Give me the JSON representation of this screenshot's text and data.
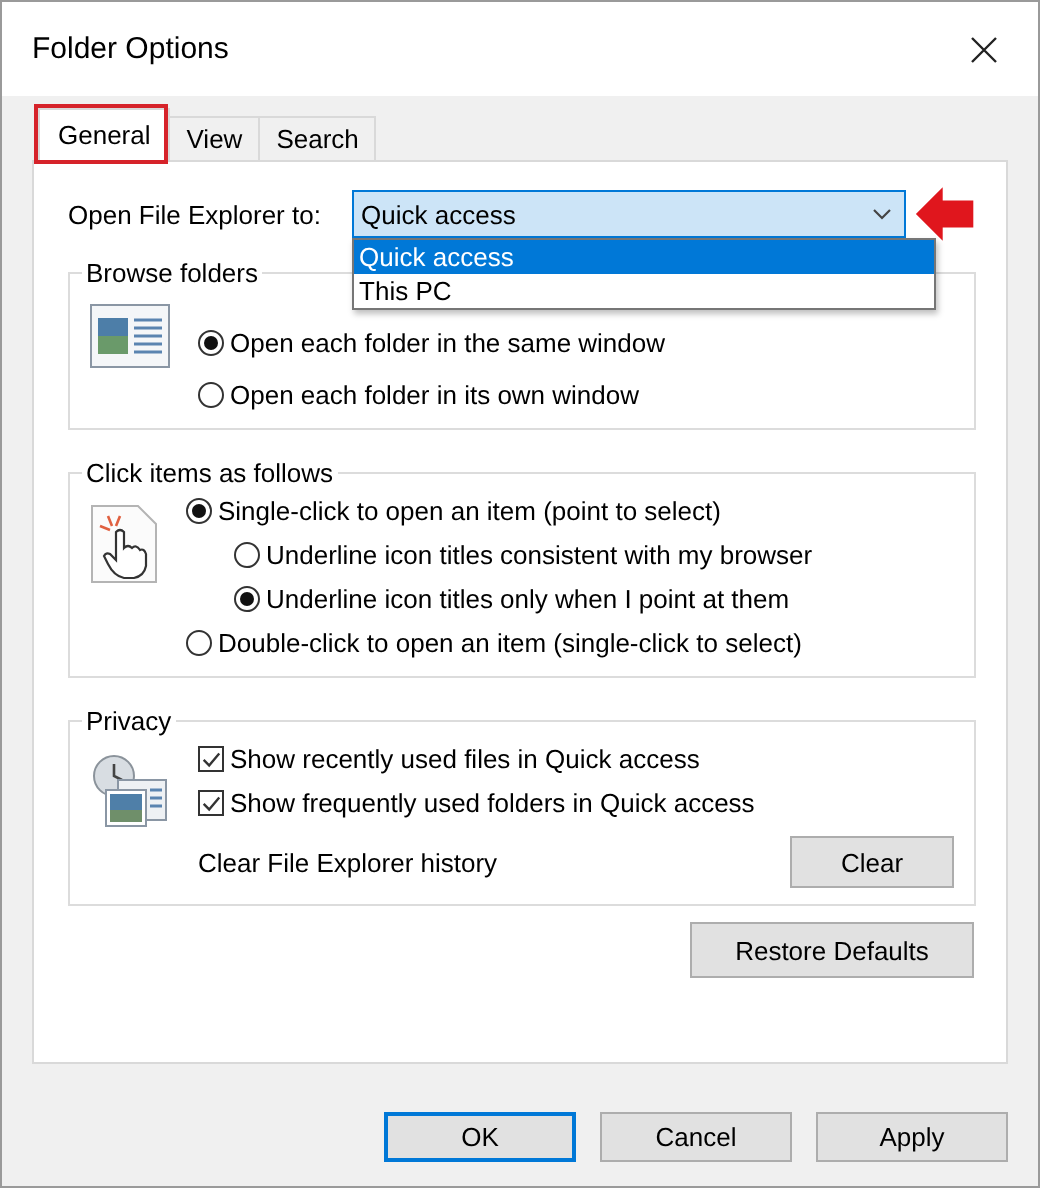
{
  "window": {
    "title": "Folder Options"
  },
  "tabs": [
    {
      "label": "General",
      "selected": true
    },
    {
      "label": "View",
      "selected": false
    },
    {
      "label": "Search",
      "selected": false
    }
  ],
  "open_to": {
    "label": "Open File Explorer to:",
    "value": "Quick access",
    "expanded": true,
    "options": [
      {
        "label": "Quick access",
        "selected": true
      },
      {
        "label": "This PC",
        "selected": false
      }
    ]
  },
  "groups": [
    {
      "title": "Browse folders",
      "kind": "browse",
      "options": [
        {
          "label": "Open each folder in the same window",
          "kind": "radio",
          "checked": true
        },
        {
          "label": "Open each folder in its own window",
          "kind": "radio",
          "checked": false
        }
      ]
    },
    {
      "title": "Click items as follows",
      "kind": "click",
      "options": [
        {
          "label": "Single-click to open an item (point to select)",
          "kind": "radio",
          "checked": true,
          "children": [
            {
              "label": "Underline icon titles consistent with my browser",
              "kind": "radio",
              "checked": false
            },
            {
              "label": "Underline icon titles only when I point at them",
              "kind": "radio",
              "checked": true
            }
          ]
        },
        {
          "label": "Double-click to open an item (single-click to select)",
          "kind": "radio",
          "checked": false
        }
      ]
    },
    {
      "title": "Privacy",
      "kind": "privacy",
      "options": [
        {
          "label": "Show recently used files in Quick access",
          "kind": "checkbox",
          "checked": true
        },
        {
          "label": "Show frequently used folders in Quick access",
          "kind": "checkbox",
          "checked": true
        }
      ],
      "clear": {
        "label": "Clear File Explorer history",
        "button": "Clear"
      }
    }
  ],
  "restore_button": "Restore Defaults",
  "buttons": [
    {
      "label": "OK",
      "default": true
    },
    {
      "label": "Cancel",
      "default": false
    },
    {
      "label": "Apply",
      "default": false
    }
  ]
}
